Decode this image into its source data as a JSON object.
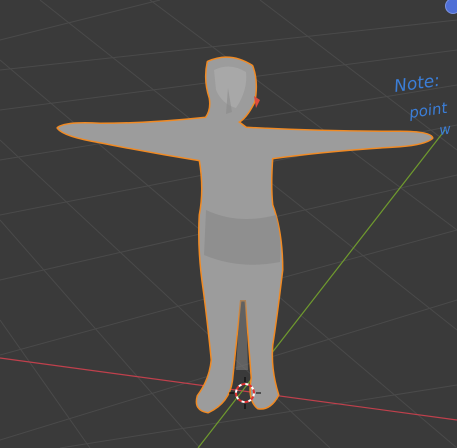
{
  "viewport": {
    "background": "#3a3a3a",
    "grid_color": "#4a4a4a",
    "x_axis_color": "#c0404c",
    "y_axis_color": "#6f9a2e",
    "selection_outline_color": "#f08a24",
    "mesh_color": "#9c9c9c"
  },
  "annotation": {
    "lines": [
      "Note:",
      "point",
      "w"
    ],
    "color": "#3b7ed8"
  },
  "gizmo": {
    "icon": "navigation-gizmo-icon",
    "color": "#4f6fd6"
  },
  "cursor": {
    "icon": "3d-cursor-icon"
  }
}
